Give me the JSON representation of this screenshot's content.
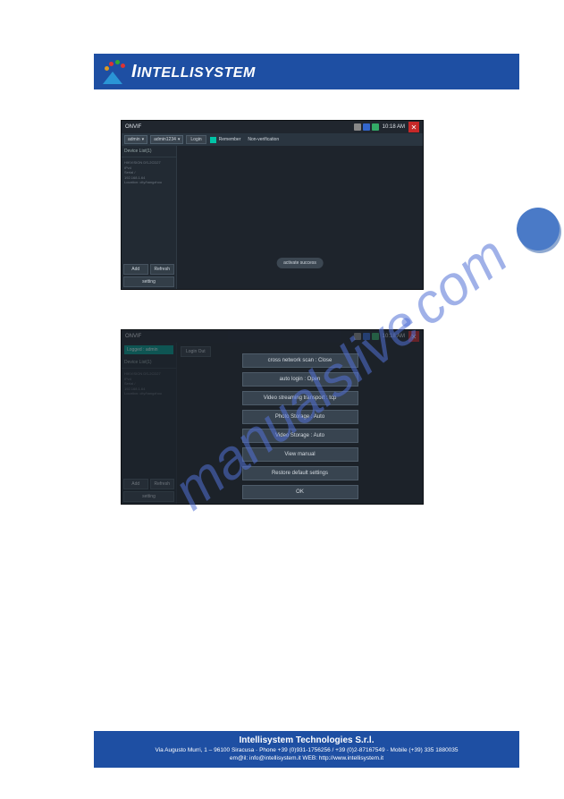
{
  "brand": {
    "name": "Intellisystem"
  },
  "circle_badge": {},
  "watermark": {
    "text": "manualslive.com",
    "text_color": "#5271d6",
    "dot_color": "#5271d6"
  },
  "screenshot1": {
    "status": {
      "title": "ONVIF",
      "time": "10:18 AM",
      "icons": [
        "usb-icon",
        "sd-icon",
        "battery-icon"
      ]
    },
    "toolbar": {
      "user_select": "admin",
      "password_input": "admin1234",
      "login_label": "Login",
      "remember_label": "Remember",
      "nonverif_label": "Non-verification"
    },
    "sidebar": {
      "device_list_header": "Device List(1)",
      "device": {
        "model": "HIKVISION DS-2CD27",
        "res": "IPv4",
        "serial": "Serial /",
        "ip": "192.168.1.64",
        "location": "Location: city/hangzhou"
      },
      "add_label": "Add",
      "refresh_label": "Refresh",
      "setting_label": "setting"
    },
    "toast": "activate success"
  },
  "screenshot2": {
    "status": {
      "title": "ONVIF",
      "time": "10:18 AM"
    },
    "sidebar": {
      "logged_label": "Logged : admin",
      "device_list_header": "Device List(1)",
      "device": {
        "model": "HIKVISION DS-2CD27",
        "res": "IPv4",
        "serial": "Serial /",
        "ip": "192.168.1.64",
        "location": "Location: city/hangzhou"
      },
      "add_label": "Add",
      "refresh_label": "Refresh",
      "setting_label": "setting"
    },
    "logout_label": "Login Out",
    "settings": [
      "cross network scan : Close",
      "auto login   : Open",
      "Video streaming transport : tcp",
      "Photo Storage : Auto",
      "Video Storage : Auto",
      "View manual",
      "Restore default settings",
      "OK"
    ]
  },
  "footer": {
    "title": "Intellisystem Technologies S.r.l.",
    "line1_a": "Via Augusto Murri, 1 – 96100 Siracusa",
    "line1_b": "Phone +39 (0)931-1756256 / +39 (0)2-87167549",
    "line1_c": "Mobile (+39) 335 1880035",
    "line2": "em@il: info@intellisystem.it WEB: http://www.intellisystem.it"
  }
}
